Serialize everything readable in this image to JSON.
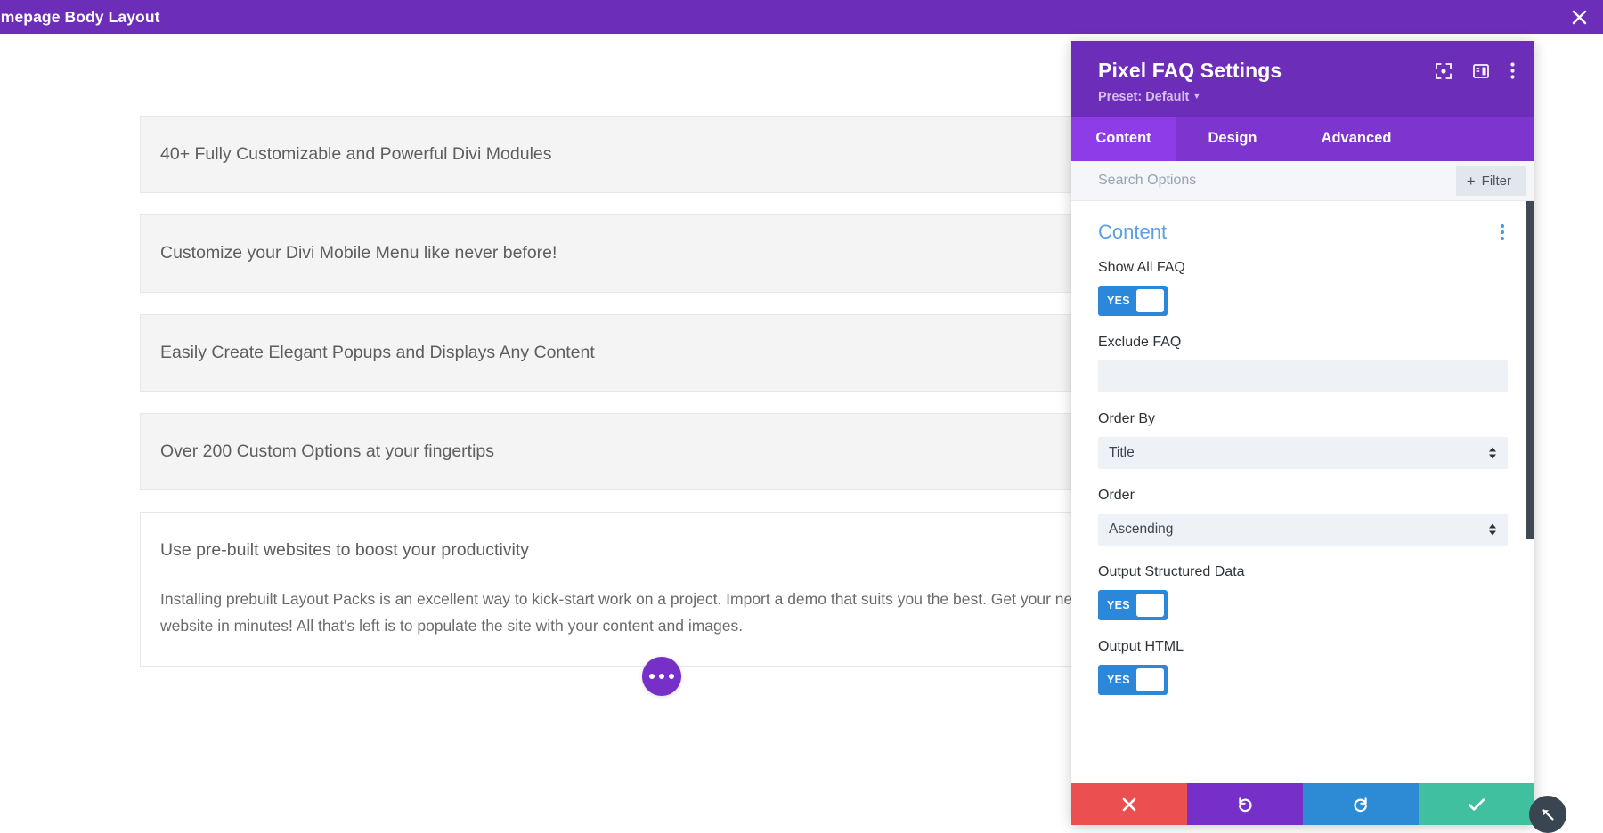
{
  "top_bar": {
    "title": "omepage Body Layout",
    "close_icon": "close-icon"
  },
  "canvas": {
    "faq_items": [
      {
        "question": "40+ Fully Customizable and Powerful Divi Modules",
        "answer": "",
        "open": false
      },
      {
        "question": "Customize your Divi Mobile Menu like never before!",
        "answer": "",
        "open": false
      },
      {
        "question": "Easily Create Elegant Popups and Displays Any Content",
        "answer": "",
        "open": false
      },
      {
        "question": "Over 200 Custom Options at your fingertips",
        "answer": "",
        "open": false
      },
      {
        "question": "Use pre-built websites to boost your productivity",
        "answer": "Installing prebuilt Layout Packs is an excellent way to kick-start work on a project. Import a demo that suits you the best. Get your new website in minutes! All that's left is to populate the site with your content and images.",
        "open": true
      }
    ],
    "fab_icon": "ellipsis-icon"
  },
  "settings_panel": {
    "title": "Pixel FAQ Settings",
    "preset_label": "Preset: Default",
    "header_icons": [
      {
        "name": "focus-target-icon"
      },
      {
        "name": "layout-panel-icon"
      },
      {
        "name": "more-vertical-icon"
      }
    ],
    "tabs": [
      {
        "label": "Content",
        "active": true
      },
      {
        "label": "Design",
        "active": false
      },
      {
        "label": "Advanced",
        "active": false
      }
    ],
    "search": {
      "value": "",
      "placeholder": "Search Options"
    },
    "filter_button": {
      "label": "Filter",
      "plus": "+"
    },
    "section": {
      "title": "Content",
      "kebab_icon": "more-vertical-icon"
    },
    "fields": {
      "show_all_faq": {
        "label": "Show All FAQ",
        "value": "YES"
      },
      "exclude_faq": {
        "label": "Exclude FAQ",
        "value": "",
        "placeholder": ""
      },
      "order_by": {
        "label": "Order By",
        "value": "Title"
      },
      "order": {
        "label": "Order",
        "value": "Ascending"
      },
      "output_structured_data": {
        "label": "Output Structured Data",
        "value": "YES"
      },
      "output_html": {
        "label": "Output HTML",
        "value": "YES"
      }
    },
    "footer_actions": [
      {
        "name": "cancel-button",
        "icon": "close-icon"
      },
      {
        "name": "undo-button",
        "icon": "undo-icon"
      },
      {
        "name": "redo-button",
        "icon": "redo-icon"
      },
      {
        "name": "save-button",
        "icon": "check-icon"
      }
    ]
  },
  "colors": {
    "brand_purple": "#6c2eb9",
    "tab_active": "#8e3ce8",
    "toggle_blue": "#2b87da",
    "section_heading": "#5d9fe0",
    "cancel_red": "#eb4f50",
    "undo_purple": "#7630c9",
    "redo_blue": "#2d8ad4",
    "save_green": "#41c0a0"
  }
}
